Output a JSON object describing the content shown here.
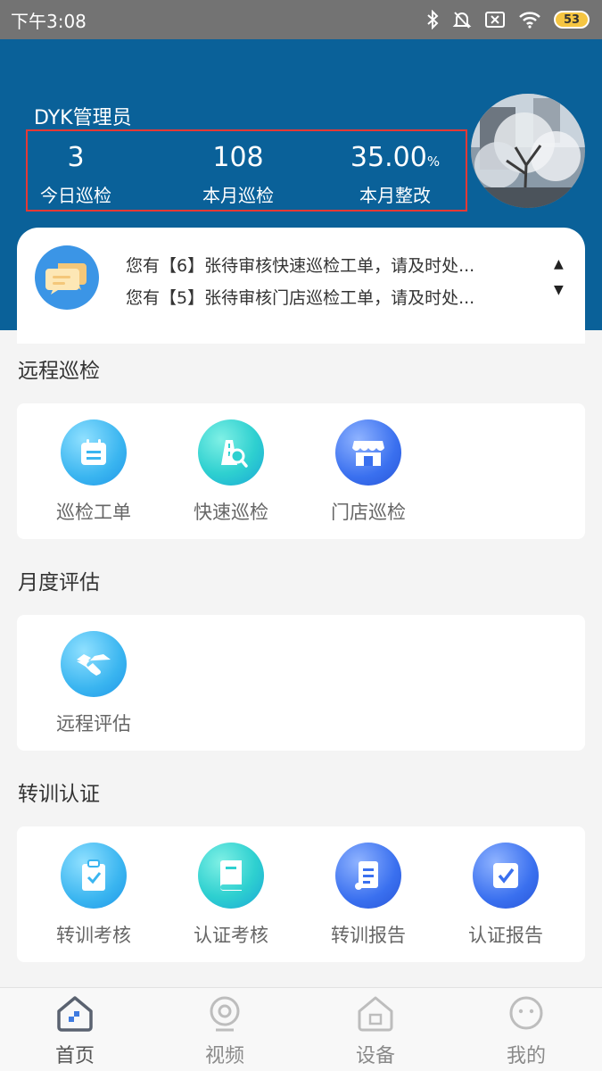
{
  "status_bar": {
    "time": "下午3:08",
    "battery": "53"
  },
  "header": {
    "user_name": "DYK管理员",
    "stats": [
      {
        "value": "3",
        "unit": "",
        "label": "今日巡检"
      },
      {
        "value": "108",
        "unit": "",
        "label": "本月巡检"
      },
      {
        "value": "35.00",
        "unit": "%",
        "label": "本月整改"
      }
    ]
  },
  "notices": [
    "您有【6】张待审核快速巡检工单，请及时处...",
    "您有【5】张待审核门店巡检工单，请及时处..."
  ],
  "sections": [
    {
      "title": "远程巡检",
      "items": [
        "巡检工单",
        "快速巡检",
        "门店巡检"
      ]
    },
    {
      "title": "月度评估",
      "items": [
        "远程评估"
      ]
    },
    {
      "title": "转训认证",
      "items": [
        "转训考核",
        "认证考核",
        "转训报告",
        "认证报告"
      ]
    }
  ],
  "tabbar": {
    "items": [
      "首页",
      "视频",
      "设备",
      "我的"
    ],
    "active_index": 0
  },
  "colors": {
    "header_bg": "#0a6199",
    "highlight_border": "#e53935",
    "notice_icon": "#3b95e6"
  }
}
